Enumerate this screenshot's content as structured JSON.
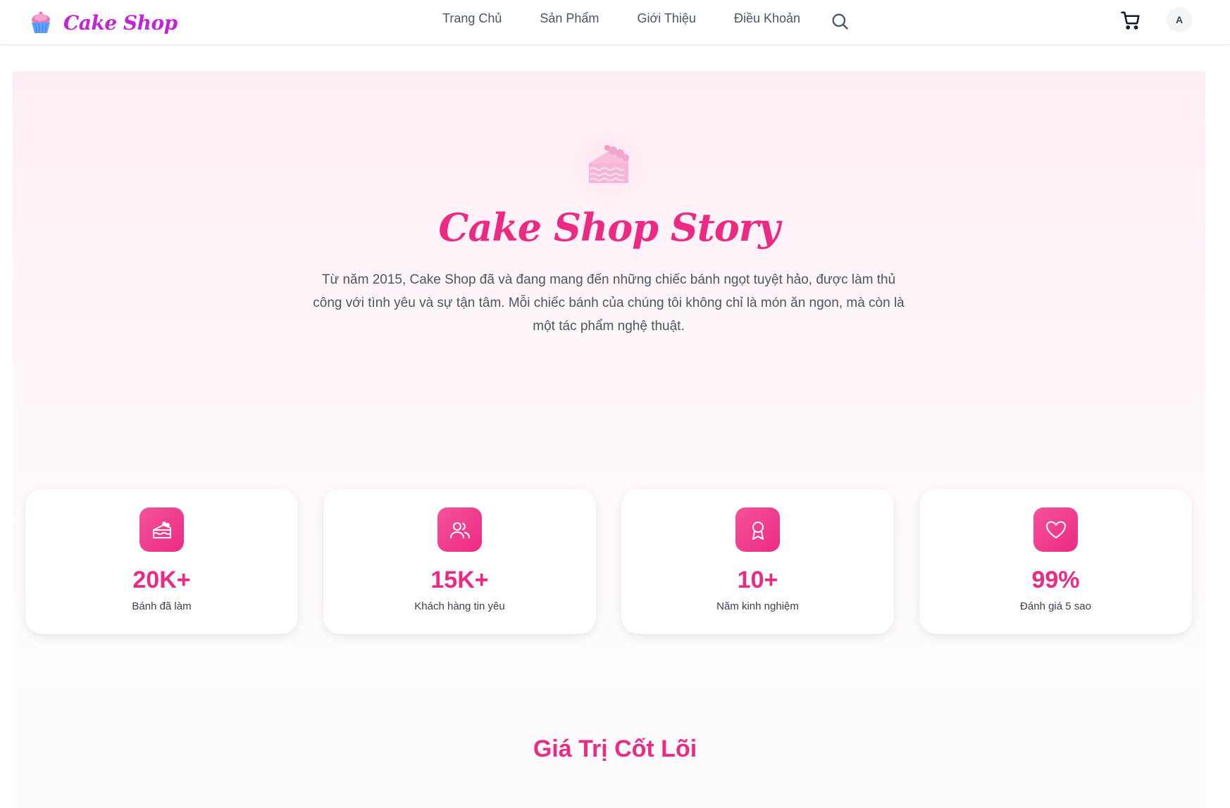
{
  "brand": {
    "name": "Cake Shop",
    "logo_icon": "cupcake-icon"
  },
  "nav": {
    "links": [
      {
        "label": "Trang Chủ"
      },
      {
        "label": "Sản Phẩm"
      },
      {
        "label": "Giới Thiệu"
      },
      {
        "label": "Điều Khoản"
      }
    ],
    "search_icon": "search-icon",
    "cart_icon": "cart-icon",
    "avatar_initial": "A"
  },
  "hero": {
    "icon": "cake-slice-icon",
    "title": "Cake Shop Story",
    "description": "Từ năm 2015, Cake Shop đã và đang mang đến những chiếc bánh ngọt tuyệt hảo, được làm thủ công với tình yêu và sự tận tâm. Mỗi chiếc bánh của chúng tôi không chỉ là món ăn ngon, mà còn là một tác phẩm nghệ thuật."
  },
  "stats": [
    {
      "icon": "cake-slice-icon",
      "value": "20K+",
      "label": "Bánh đã làm"
    },
    {
      "icon": "users-icon",
      "value": "15K+",
      "label": "Khách hàng tin yêu"
    },
    {
      "icon": "award-icon",
      "value": "10+",
      "label": "Năm kinh nghiệm"
    },
    {
      "icon": "heart-icon",
      "value": "99%",
      "label": "Đánh giá 5 sao"
    }
  ],
  "core_values": {
    "title": "Giá Trị Cốt Lõi"
  },
  "colors": {
    "accent": "#ec2a83",
    "brand_text": "#c026d3",
    "hero_bg": "#fdeef5"
  }
}
